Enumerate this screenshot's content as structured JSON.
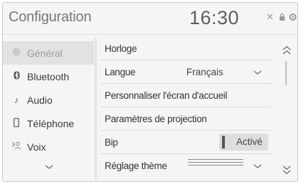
{
  "header": {
    "title": "Configuration",
    "clock": "16:30",
    "status_icons": [
      "signal-icon",
      "lock-icon",
      "settings-icon"
    ]
  },
  "sidebar": {
    "items": [
      {
        "label": "Général",
        "icon": "gear-icon",
        "active": true
      },
      {
        "label": "Bluetooth",
        "icon": "bluetooth-icon",
        "active": false
      },
      {
        "label": "Audio",
        "icon": "music-note-icon",
        "active": false
      },
      {
        "label": "Téléphone",
        "icon": "phone-icon",
        "active": false
      },
      {
        "label": "Voix",
        "icon": "voice-icon",
        "active": false
      }
    ],
    "more_icon": "chevron-down-icon"
  },
  "settings": {
    "rows": [
      {
        "label": "Horloge"
      },
      {
        "label": "Langue",
        "value": "Français",
        "control": "dropdown"
      },
      {
        "label": "Personnaliser l'écran d'accueil"
      },
      {
        "label": "Paramètres de projection"
      },
      {
        "label": "Bip",
        "toggle_label": "Activé",
        "toggle_on": true
      },
      {
        "label": "Réglage thème",
        "control": "dropdown"
      }
    ]
  },
  "scroll": {
    "up_icon": "double-chevron-up-icon",
    "down_icon": "double-chevron-down-icon"
  },
  "colors": {
    "background": "#f5f5f5",
    "active_item": "#e2e2e2",
    "text": "#333333"
  }
}
